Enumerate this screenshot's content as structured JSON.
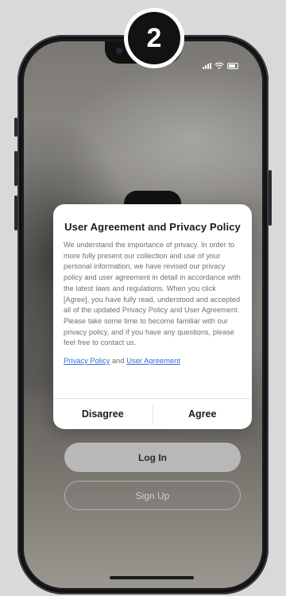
{
  "step_badge": {
    "number": "2"
  },
  "dialog": {
    "title": "User Agreement and Privacy Policy",
    "body": "We understand the importance of privacy. In order to more fully present our collection and use of your personal information, we have revised our privacy policy and user agreement in detail in accordance with the latest laws and regulations. When you click [Agree], you have fully read, understood and accepted all of the updated Privacy Policy and User Agreement. Please take some time to become familiar with our privacy policy, and if you have any questions, please feel free to contact us.",
    "privacy_link": "Privacy Policy",
    "and_text": "and",
    "user_agreement_link": "User Agreement",
    "disagree_label": "Disagree",
    "agree_label": "Agree"
  },
  "auth": {
    "login_label": "Log In",
    "signup_label": "Sign Up"
  },
  "status_bar": {
    "icons": [
      "signal-icon",
      "wifi-icon",
      "battery-icon"
    ]
  },
  "colors": {
    "link": "#2f6fd8",
    "badge_bg": "#121212",
    "dialog_bg": "#ffffff"
  }
}
